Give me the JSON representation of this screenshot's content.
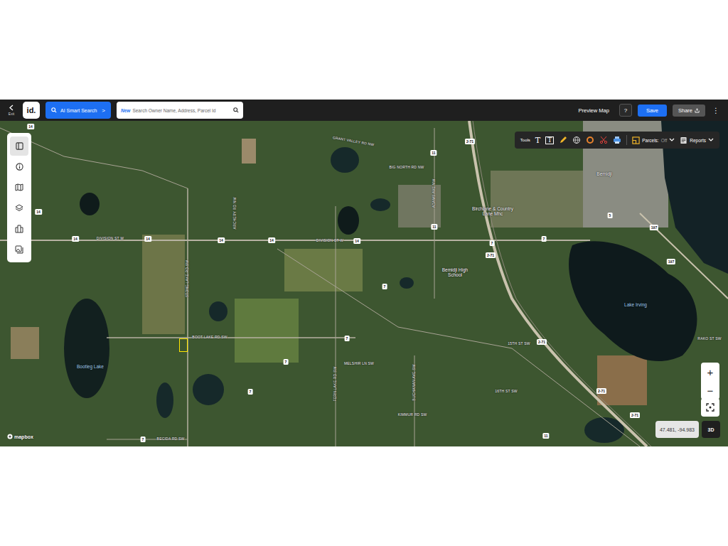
{
  "header": {
    "exit": "Exit",
    "logo": "id.",
    "ai_search": {
      "label": "AI Smart Search",
      "chevron": ">"
    },
    "search": {
      "badge": "New",
      "placeholder": "Search Owner Name, Address, Parcel Id"
    },
    "preview": "Preview Map",
    "help": "?",
    "save": "Save",
    "share": "Share",
    "more": "⋮"
  },
  "sidebar": {
    "items": [
      {
        "kind": "panel",
        "selected": true
      },
      {
        "kind": "info",
        "selected": false
      },
      {
        "kind": "map",
        "selected": false
      },
      {
        "kind": "layers",
        "selected": false
      },
      {
        "kind": "places",
        "selected": false
      },
      {
        "kind": "gallery",
        "selected": false
      }
    ]
  },
  "toolbar": {
    "label": "Tools",
    "text_tool": "T",
    "text_box_tool": "T",
    "parcels": {
      "label": "Parcels:",
      "value": "Off",
      "on": false
    },
    "reports": "Reports"
  },
  "map": {
    "labels": [
      {
        "text": "Bemidji",
        "kind": "place"
      },
      {
        "text": "Birchlane & Country Lane Mhc",
        "kind": "place"
      },
      {
        "text": "Bemidji High School",
        "kind": "place"
      },
      {
        "text": "Lake Irving",
        "kind": "water"
      },
      {
        "text": "Bootleg Lake",
        "kind": "water"
      },
      {
        "text": "DIVISION ST W",
        "kind": "road"
      },
      {
        "text": "DIVISION ST W",
        "kind": "road"
      },
      {
        "text": "BOOT LAKE RD SW",
        "kind": "road"
      },
      {
        "text": "GRANT VALLEY RD NW",
        "kind": "road"
      },
      {
        "text": "BIG NORTH RD NW",
        "kind": "road"
      },
      {
        "text": "15TH ST SW",
        "kind": "road"
      },
      {
        "text": "16TH ST SW",
        "kind": "road"
      },
      {
        "text": "KIMMUR RD SW",
        "kind": "road"
      },
      {
        "text": "MELSHIR LN SW",
        "kind": "road"
      },
      {
        "text": "BECIDA RD SW",
        "kind": "road"
      },
      {
        "text": "RAKO ST SW",
        "kind": "road"
      },
      {
        "text": "STONE LAKE RD SW",
        "kind": "road"
      },
      {
        "text": "FERN LAKE RD SW",
        "kind": "road"
      },
      {
        "text": "BUCHANAN AVE SW",
        "kind": "road"
      },
      {
        "text": "ARCHERY RD NW",
        "kind": "road"
      },
      {
        "text": "ADAMS AVE NW",
        "kind": "road"
      }
    ],
    "shields": [
      "14",
      "14",
      "14",
      "14",
      "14",
      "14",
      "14",
      "2-71",
      "2-71",
      "2-71",
      "2-71",
      "2-71",
      "11",
      "11",
      "11",
      "7",
      "7",
      "7",
      "7",
      "7",
      "7",
      "7",
      "197",
      "197",
      "5"
    ],
    "attribution": "mapbox",
    "zoom_in": "+",
    "zoom_out": "−",
    "coordinates": "47.481, -94.983",
    "view_3d": "3D"
  }
}
